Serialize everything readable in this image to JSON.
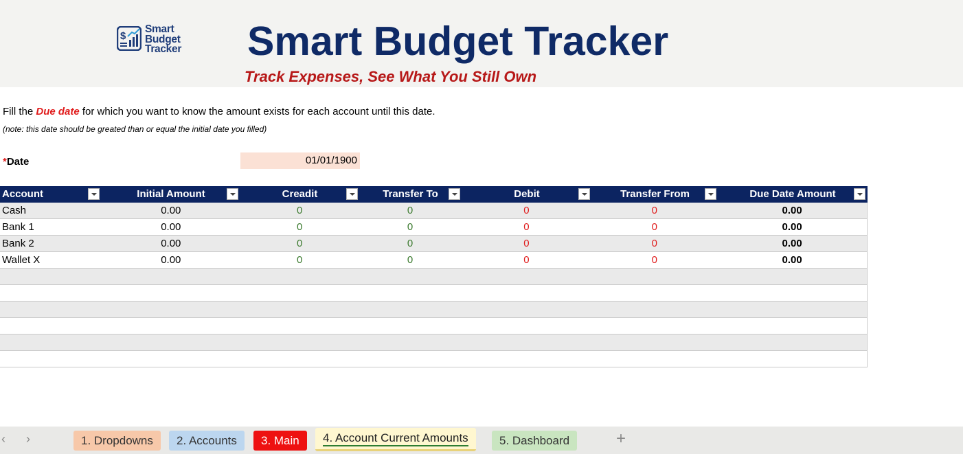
{
  "header": {
    "logo_lines": [
      "Smart",
      "Budget",
      "Tracker"
    ],
    "title": "Smart Budget Tracker",
    "subtitle": "Track Expenses, See What You Still Own"
  },
  "instructions": {
    "prefix": "Fill the ",
    "highlight": "Due date",
    "suffix": "  for which you want to know the amount exists for each account until this date.",
    "note": "(note: this date should be greated than or equal the initial date you filled)"
  },
  "date_field": {
    "asterisk": "*",
    "label": "Date",
    "value": "01/01/1900"
  },
  "table": {
    "columns": [
      "Account",
      "Initial Amount",
      "Creadit",
      "Transfer To",
      "Debit",
      "Transfer From",
      "Due Date Amount"
    ],
    "rows": [
      {
        "account": "Cash",
        "initial": "0.00",
        "credit": "0",
        "transfer_to": "0",
        "debit": "0",
        "transfer_from": "0",
        "due": "0.00"
      },
      {
        "account": "Bank 1",
        "initial": "0.00",
        "credit": "0",
        "transfer_to": "0",
        "debit": "0",
        "transfer_from": "0",
        "due": "0.00"
      },
      {
        "account": "Bank 2",
        "initial": "0.00",
        "credit": "0",
        "transfer_to": "0",
        "debit": "0",
        "transfer_from": "0",
        "due": "0.00"
      },
      {
        "account": "Wallet X",
        "initial": "0.00",
        "credit": "0",
        "transfer_to": "0",
        "debit": "0",
        "transfer_from": "0",
        "due": "0.00"
      }
    ]
  },
  "sheet_tabs": {
    "prev_icon": "‹",
    "next_icon": "›",
    "tabs": [
      "1. Dropdowns",
      "2. Accounts",
      "3. Main",
      "4. Account Current Amounts",
      "5. Dashboard"
    ],
    "active": "4. Account Current Amounts",
    "add_icon": "+"
  },
  "colors": {
    "header_bg": "#0c2461",
    "title": "#0f2a66",
    "subtitle": "#b71818",
    "credit": "#3b7a2e",
    "debit": "#e01b1b",
    "date_bg": "#fbe1d5"
  }
}
